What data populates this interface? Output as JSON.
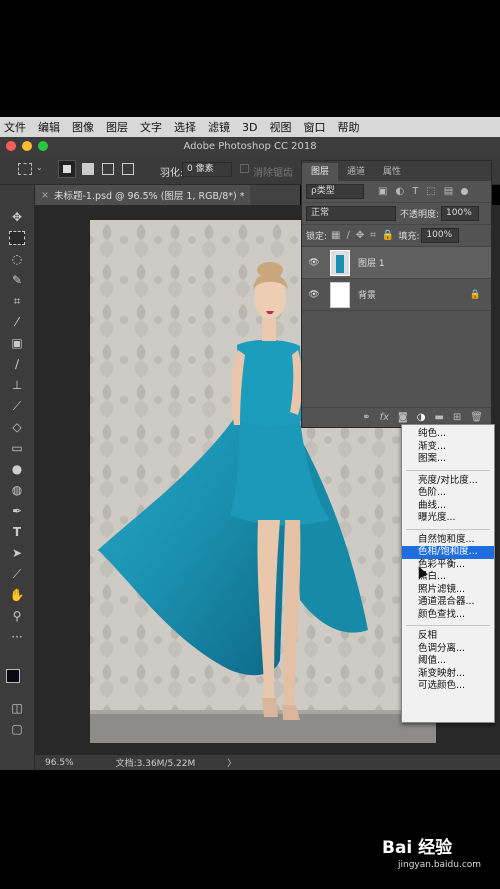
{
  "menubar": {
    "items": [
      "文件",
      "编辑",
      "图像",
      "图层",
      "文字",
      "选择",
      "滤镜",
      "3D",
      "视图",
      "窗口",
      "帮助"
    ]
  },
  "window": {
    "title": "Adobe Photoshop CC 2018",
    "colors": {
      "close": "#ff5f57",
      "minimize": "#febc2e",
      "zoom": "#28c840"
    }
  },
  "options": {
    "feather_label": "羽化:",
    "feather_value": "0 像素",
    "antialias_label": "消除锯齿"
  },
  "document": {
    "tab_title": "未标题-1.psd @ 96.5% (图层 1, RGB/8*) *",
    "tab_close": "×"
  },
  "status": {
    "zoom": "96.5%",
    "doc_size": "文档:3.36M/5.22M",
    "arrow": "〉"
  },
  "layers_panel": {
    "tabs": [
      "图层",
      "通道",
      "属性"
    ],
    "filter_kind": "ρ类型",
    "blend_mode": "正常",
    "opacity_label": "不透明度:",
    "opacity_value": "100%",
    "lock_label": "锁定:",
    "fill_label": "填充:",
    "fill_value": "100%",
    "layers": [
      {
        "name": "图层 1"
      },
      {
        "name": "背景"
      }
    ]
  },
  "adjust_menu": {
    "groups": [
      [
        "纯色...",
        "渐变...",
        "图案..."
      ],
      [
        "亮度/对比度...",
        "色阶...",
        "曲线...",
        "曝光度..."
      ],
      [
        "自然饱和度...",
        "色相/饱和度...",
        "色彩平衡...",
        "黑白...",
        "照片滤镜...",
        "通道混合器...",
        "颜色查找..."
      ],
      [
        "反相",
        "色调分离...",
        "阈值...",
        "渐变映射...",
        "可选颜色..."
      ]
    ],
    "highlighted": "色相/饱和度..."
  },
  "watermark": {
    "brand": "Bai 经验",
    "url": "jingyan.baidu.com"
  },
  "colors": {
    "dress": "#1a8fae",
    "highlight": "#1e6ee0"
  }
}
